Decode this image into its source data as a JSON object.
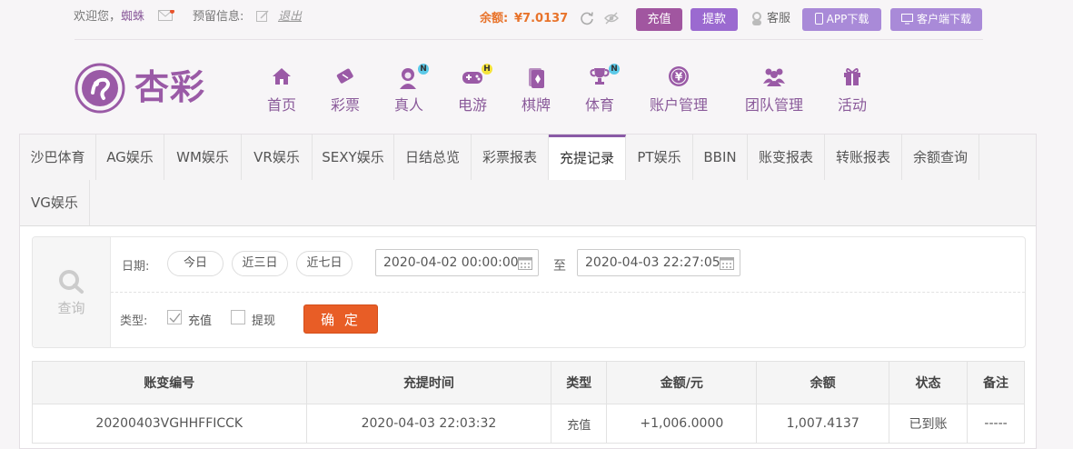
{
  "topbar": {
    "welcome": "欢迎您，",
    "username": "蜘蛛",
    "reserve_label": "预留信息:",
    "logout": "退出",
    "balance_label": "余额:",
    "balance_value": "¥7.0137",
    "recharge": "充值",
    "withdraw": "提款",
    "service": "客服",
    "app_download": "APP下载",
    "client_download": "客户端下载"
  },
  "logo": {
    "text": "杏彩"
  },
  "nav": [
    {
      "label": "首页",
      "icon": "home-icon"
    },
    {
      "label": "彩票",
      "icon": "lottery-ticket-icon"
    },
    {
      "label": "真人",
      "icon": "live-dealer-icon",
      "badge": "N"
    },
    {
      "label": "电游",
      "icon": "gamepad-icon",
      "badge": "H"
    },
    {
      "label": "棋牌",
      "icon": "cards-icon"
    },
    {
      "label": "体育",
      "icon": "trophy-icon",
      "badge": "N"
    },
    {
      "label": "账户管理",
      "icon": "yen-coin-icon"
    },
    {
      "label": "团队管理",
      "icon": "team-icon"
    },
    {
      "label": "活动",
      "icon": "gift-icon"
    }
  ],
  "tabs": [
    "沙巴体育",
    "AG娱乐",
    "WM娱乐",
    "VR娱乐",
    "SEXY娱乐",
    "日结总览",
    "彩票报表",
    "充提记录",
    "PT娱乐",
    "BBIN",
    "账变报表",
    "转账报表",
    "余额查询",
    "VG娱乐"
  ],
  "active_tab": "充提记录",
  "query": {
    "side_label": "查询",
    "date_label": "日期:",
    "quick_ranges": [
      "今日",
      "近三日",
      "近七日"
    ],
    "start_date": "2020-04-02 00:00:00",
    "to_label": "至",
    "end_date": "2020-04-03 22:27:05",
    "type_label": "类型:",
    "type_recharge": "充值",
    "type_recharge_checked": true,
    "type_withdraw": "提现",
    "type_withdraw_checked": false,
    "confirm": "确 定"
  },
  "table": {
    "headers": [
      "账变编号",
      "充提时间",
      "类型",
      "金额/元",
      "余额",
      "状态",
      "备注"
    ],
    "rows": [
      [
        "20200403VGHHFFICCK",
        "2020-04-03 22:03:32",
        "充值",
        "+1,006.0000",
        "1,007.4137",
        "已到账",
        "-----"
      ]
    ]
  },
  "colors": {
    "brand": "#8a5aa6",
    "accent_orange": "#e8732b",
    "confirm": "#e85d26",
    "success": "#2a9a2a",
    "amount": "#d2322d"
  }
}
